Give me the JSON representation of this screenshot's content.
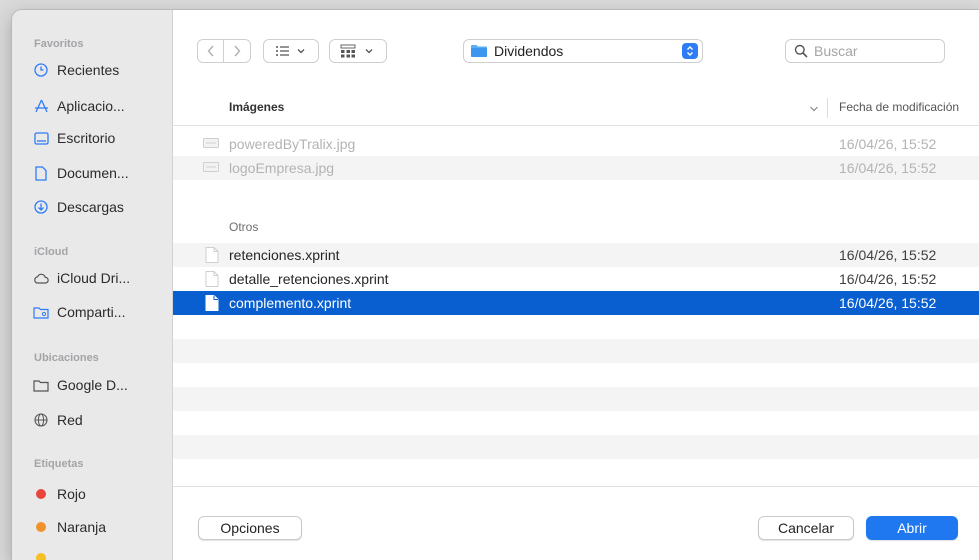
{
  "sidebar": {
    "favoritos_heading": "Favoritos",
    "favorites": [
      {
        "label": "Recientes",
        "icon": "clock-icon"
      },
      {
        "label": "Aplicacio...",
        "icon": "applications-icon"
      },
      {
        "label": "Escritorio",
        "icon": "desktop-icon"
      },
      {
        "label": "Documen...",
        "icon": "document-icon"
      },
      {
        "label": "Descargas",
        "icon": "download-icon"
      }
    ],
    "icloud_heading": "iCloud",
    "icloud": [
      {
        "label": "iCloud Dri...",
        "icon": "cloud-icon"
      },
      {
        "label": "Comparti...",
        "icon": "shared-folder-icon"
      }
    ],
    "ubicaciones_heading": "Ubicaciones",
    "ubicaciones": [
      {
        "label": "Google D...",
        "icon": "drive-icon"
      },
      {
        "label": "Red",
        "icon": "globe-icon"
      }
    ],
    "etiquetas_heading": "Etiquetas",
    "etiquetas": [
      {
        "label": "Rojo",
        "color": "#e8463c"
      },
      {
        "label": "Naranja",
        "color": "#f0922b"
      }
    ],
    "partial_tag_color": "#f5c026"
  },
  "toolbar": {
    "location": "Dividendos",
    "search_placeholder": "Buscar"
  },
  "list": {
    "column_name": "Imágenes",
    "column_date": "Fecha de modificación",
    "images": [
      {
        "name": "poweredByTralix.jpg",
        "date": "16/04/26, 15:52"
      },
      {
        "name": "logoEmpresa.jpg",
        "date": "16/04/26, 15:52"
      }
    ],
    "otros_label": "Otros",
    "otros": [
      {
        "name": "retenciones.xprint",
        "date": "16/04/26, 15:52"
      },
      {
        "name": "detalle_retenciones.xprint",
        "date": "16/04/26, 15:52"
      },
      {
        "name": "complemento.xprint",
        "date": "16/04/26, 15:52"
      }
    ]
  },
  "buttons": {
    "options": "Opciones",
    "cancel": "Cancelar",
    "open": "Abrir"
  },
  "colors": {
    "accent": "#1f78f0",
    "selection": "#0a5fd0"
  }
}
